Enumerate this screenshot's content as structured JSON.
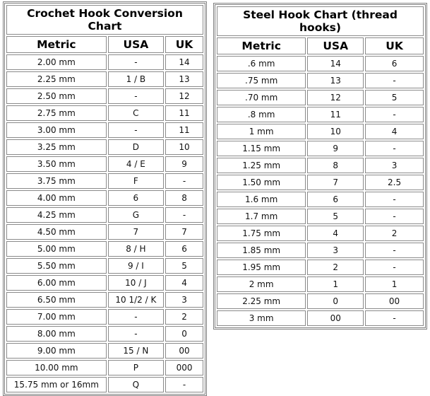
{
  "crochet_chart": {
    "title": "Crochet Hook Conversion Chart",
    "columns": [
      "Metric",
      "USA",
      "UK"
    ],
    "rows": [
      [
        "2.00 mm",
        "-",
        "14"
      ],
      [
        "2.25 mm",
        "1 / B",
        "13"
      ],
      [
        "2.50 mm",
        "-",
        "12"
      ],
      [
        "2.75 mm",
        "C",
        "11"
      ],
      [
        "3.00 mm",
        "-",
        "11"
      ],
      [
        "3.25 mm",
        "D",
        "10"
      ],
      [
        "3.50 mm",
        "4 / E",
        "9"
      ],
      [
        "3.75 mm",
        "F",
        "-"
      ],
      [
        "4.00 mm",
        "6",
        "8"
      ],
      [
        "4.25 mm",
        "G",
        "-"
      ],
      [
        "4.50 mm",
        "7",
        "7"
      ],
      [
        "5.00 mm",
        "8 / H",
        "6"
      ],
      [
        "5.50 mm",
        "9 / I",
        "5"
      ],
      [
        "6.00 mm",
        "10 / J",
        "4"
      ],
      [
        "6.50 mm",
        "10 1/2 / K",
        "3"
      ],
      [
        "7.00 mm",
        "-",
        "2"
      ],
      [
        "8.00 mm",
        "-",
        "0"
      ],
      [
        "9.00 mm",
        "15 / N",
        "00"
      ],
      [
        "10.00 mm",
        "P",
        "000"
      ],
      [
        "15.75 mm or 16mm",
        "Q",
        "-"
      ]
    ]
  },
  "steel_chart": {
    "title": "Steel Hook Chart (thread hooks)",
    "columns": [
      "Metric",
      "USA",
      "UK"
    ],
    "rows": [
      [
        ".6 mm",
        "14",
        "6"
      ],
      [
        ".75 mm",
        "13",
        "-"
      ],
      [
        ".70 mm",
        "12",
        "5"
      ],
      [
        ".8 mm",
        "11",
        "-"
      ],
      [
        "1 mm",
        "10",
        "4"
      ],
      [
        "1.15 mm",
        "9",
        "-"
      ],
      [
        "1.25 mm",
        "8",
        "3"
      ],
      [
        "1.50 mm",
        "7",
        "2.5"
      ],
      [
        "1.6 mm",
        "6",
        "-"
      ],
      [
        "1.7 mm",
        "5",
        "-"
      ],
      [
        "1.75 mm",
        "4",
        "2"
      ],
      [
        "1.85 mm",
        "3",
        "-"
      ],
      [
        "1.95 mm",
        "2",
        "-"
      ],
      [
        "2 mm",
        "1",
        "1"
      ],
      [
        "2.25 mm",
        "0",
        "00"
      ],
      [
        "3 mm",
        "00",
        "-"
      ]
    ]
  }
}
